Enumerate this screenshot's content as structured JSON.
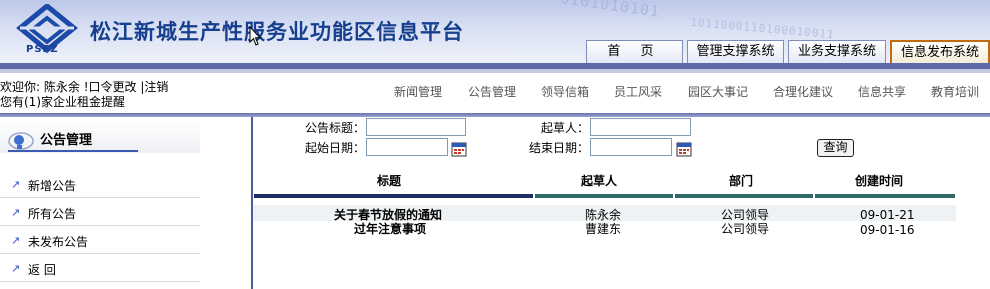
{
  "header": {
    "site_title": "松江新城生产性服务业功能区信息平台",
    "logo_text": "PSFZ",
    "binary_decor": "0101010101",
    "binary_decor2": "1011000110100010011",
    "tabs": [
      {
        "label": "首 页"
      },
      {
        "label": "管理支撑系统"
      },
      {
        "label": "业务支撑系统"
      },
      {
        "label": "信息发布系统"
      }
    ]
  },
  "userbar": {
    "welcome_prefix": "欢迎你: ",
    "user_name": "陈永余",
    "change_password": "!口令更改",
    "separator": "|",
    "logout": "注销",
    "reminder": "您有(1)家企业租金提醒"
  },
  "nav": {
    "items": [
      "新闻管理",
      "公告管理",
      "领导信箱",
      "员工风采",
      "园区大事记",
      "合理化建议",
      "信息共享",
      "教育培训"
    ]
  },
  "sidebar": {
    "title": "公告管理",
    "items": [
      {
        "label": "新增公告"
      },
      {
        "label": "所有公告"
      },
      {
        "label": "未发布公告"
      },
      {
        "label": "返 回"
      }
    ]
  },
  "search": {
    "title_label": "公告标题：",
    "title_value": "",
    "drafter_label": "起草人：",
    "drafter_value": "",
    "start_date_label": "起始日期：",
    "start_date_value": "",
    "end_date_label": "结束日期：",
    "end_date_value": "",
    "query_button": "查询"
  },
  "table": {
    "columns": [
      "标题",
      "起草人",
      "部门",
      "创建时间"
    ],
    "rows": [
      {
        "title": "关于春节放假的通知",
        "drafter": "陈永余",
        "dept": "公司领导",
        "created": "09-01-21"
      },
      {
        "title": "过年注意事项",
        "drafter": "曹建东",
        "dept": "公司领导",
        "created": "09-01-16"
      }
    ]
  },
  "colors": {
    "title_blue": "#173f8f",
    "bar_blue": "#5d6aa8",
    "header_rule_navy": "#1f2f66",
    "header_rule_teal": "#2f6b66"
  }
}
